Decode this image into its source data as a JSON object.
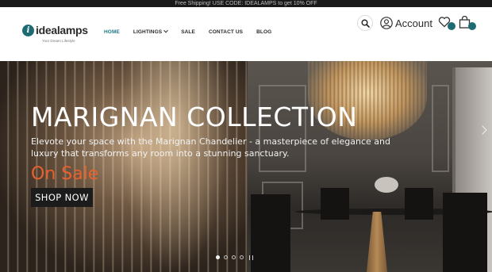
{
  "topbar": {
    "text": "Free Shipping! USE CODE: IDEALAMPS to get 10% OFF"
  },
  "brand": {
    "name": "idealamps",
    "tagline": "Your Dream Lifestyle",
    "mark": "i",
    "color": "#1f6b74"
  },
  "nav": {
    "items": [
      {
        "label": "HOME",
        "active": true
      },
      {
        "label": "LIGHTINGS",
        "has_dropdown": true
      },
      {
        "label": "SALE"
      },
      {
        "label": "CONTACT US"
      },
      {
        "label": "BLOG"
      }
    ]
  },
  "header_icons": {
    "search": "search-icon",
    "account_label": "Account",
    "account_icon": "user-icon",
    "wishlist_icon": "heart-icon",
    "cart_icon": "bag-icon"
  },
  "hero": {
    "title": "MARIGNAN COLLECTION",
    "description": "Elevote your space with the Marignan Chandelier - a masterpiece of elegance and luxury that transforms any room into a stunning sanctuary.",
    "sale_label": "On Sale",
    "cta_label": "SHOP NOW",
    "sale_color": "#e8612d",
    "slides": 4,
    "active_slide": 0
  }
}
